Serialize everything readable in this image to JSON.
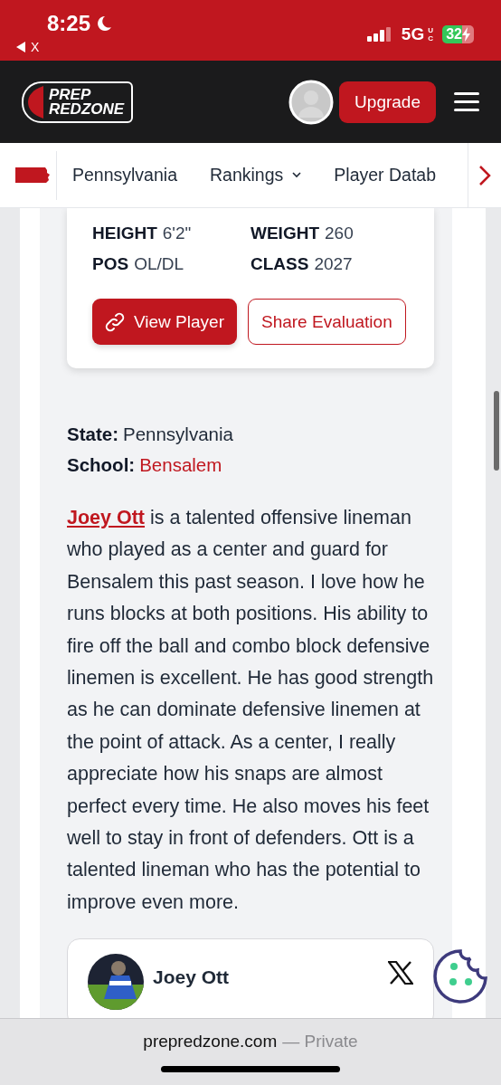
{
  "status_bar": {
    "time": "8:25",
    "back_label": "X",
    "network": "5G",
    "network_sub": "UC",
    "battery": "32"
  },
  "header": {
    "logo_top": "PREP",
    "logo_bottom": "REDZONE",
    "upgrade_label": "Upgrade"
  },
  "nav": {
    "items": [
      {
        "label": "Pennsylvania",
        "dropdown": false
      },
      {
        "label": "Rankings",
        "dropdown": true
      },
      {
        "label": "Player Datab",
        "dropdown": false
      }
    ]
  },
  "player_card": {
    "stats": [
      {
        "label": "HEIGHT",
        "value": "6'2\""
      },
      {
        "label": "WEIGHT",
        "value": "260"
      },
      {
        "label": "POS",
        "value": "OL/DL"
      },
      {
        "label": "CLASS",
        "value": "2027"
      }
    ],
    "buttons": [
      {
        "label": "View Player",
        "kind": "primary"
      },
      {
        "label": "Share Evaluation",
        "kind": "outline"
      }
    ]
  },
  "details": [
    {
      "label": "State:",
      "value": "Pennsylvania",
      "link": false
    },
    {
      "label": "School:",
      "value": "Bensalem",
      "link": true
    }
  ],
  "evaluation": {
    "link": "Joey Ott",
    "text": " is a talented offensive lineman who played as a center and guard for Bensalem this past season. I love how he runs blocks at both positions. His ability to fire off the ball and combo block defensive linemen is excellent. He has good strength as he can dominate defensive linemen at the point of attack. As a center, I really appreciate how his snaps are almost perfect every time. He also moves his feet well to stay in front of defenders. Ott is a talented lineman who has the potential to improve even more."
  },
  "embed": {
    "name": "Joey Ott"
  },
  "browser_bar": {
    "domain": "prepredzone.com",
    "mode": "— Private"
  }
}
